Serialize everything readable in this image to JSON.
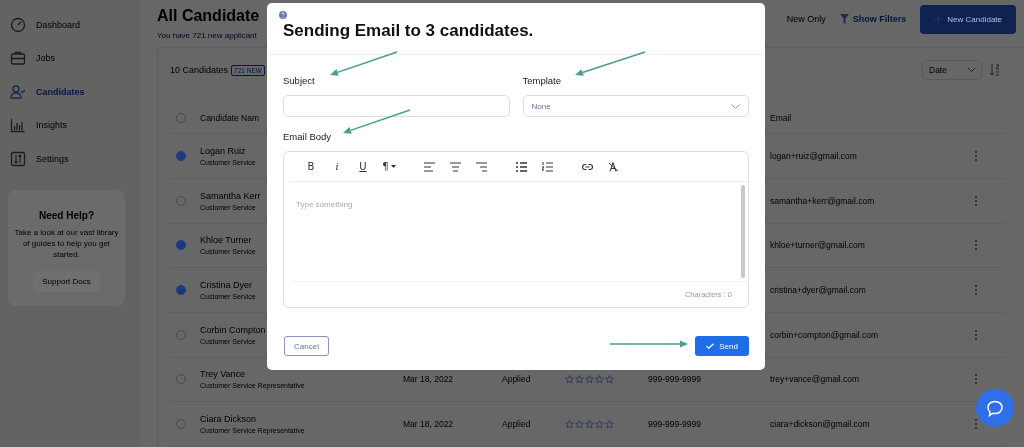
{
  "sidebar": {
    "items": [
      {
        "label": "Dashboard",
        "selected": false
      },
      {
        "label": "Jobs",
        "selected": false
      },
      {
        "label": "Candidates",
        "selected": true
      },
      {
        "label": "Insights",
        "selected": false
      },
      {
        "label": "Settings",
        "selected": false
      }
    ],
    "help_card": {
      "title": "Need Help?",
      "text": "Take a look at our vast library of guides to help you get started.",
      "button": "Support Docs"
    }
  },
  "page": {
    "title": "All Candidate",
    "subtitle": "You have 721 new applicant",
    "new_only": "New Only",
    "filters_button": "Show Filters",
    "new_button": "New Candidate"
  },
  "list": {
    "count": "10 Candidates",
    "badge": "721 NEW",
    "sort": "Date",
    "select_all_checked": false,
    "columns": {
      "name": "Candidate Nam",
      "email": "Email"
    },
    "rows": [
      {
        "name": "Logan Ruiz",
        "title": "Customer Service",
        "email": "logan+ruiz@gmail.com",
        "selected": true
      },
      {
        "name": "Samantha Kerr",
        "title": "Customer Service",
        "email": "samantha+kerr@gmail.com",
        "selected": false
      },
      {
        "name": "Khloe Turner",
        "title": "Customer Service",
        "email": "khloe+turner@gmail.com",
        "selected": true
      },
      {
        "name": "Cristina Dyer",
        "title": "Customer Service",
        "email": "cristina+dyer@gmail.com",
        "selected": true
      },
      {
        "name": "Corbin Compton",
        "title": "Customer Service",
        "email": "corbin+compton@gmail.com",
        "selected": false
      },
      {
        "name": "Trey Vance",
        "title": "Customer Service Representative",
        "date": "Mar 18, 2022",
        "status": "Applied",
        "stars": 0,
        "phone": "999-999-9999",
        "email": "trey+vance@gmail.com",
        "selected": false
      },
      {
        "name": "Ciara Dickson",
        "title": "Customer Service Representative",
        "date": "Mar 18, 2022",
        "status": "Applied",
        "stars": 0,
        "phone": "999-999-9999",
        "email": "ciara+dickson@gmail.com",
        "selected": false
      }
    ]
  },
  "modal": {
    "title": "Sending Email to 3 candidates.",
    "subject_label": "Subject",
    "template_label": "Template",
    "template_value": "None",
    "body_label": "Email Body",
    "toolbar": [
      "B",
      "i",
      "U",
      "¶"
    ],
    "body_placeholder": "Type something",
    "char_count": "Characters : 0",
    "cancel": "Cancel",
    "send": "Send"
  }
}
